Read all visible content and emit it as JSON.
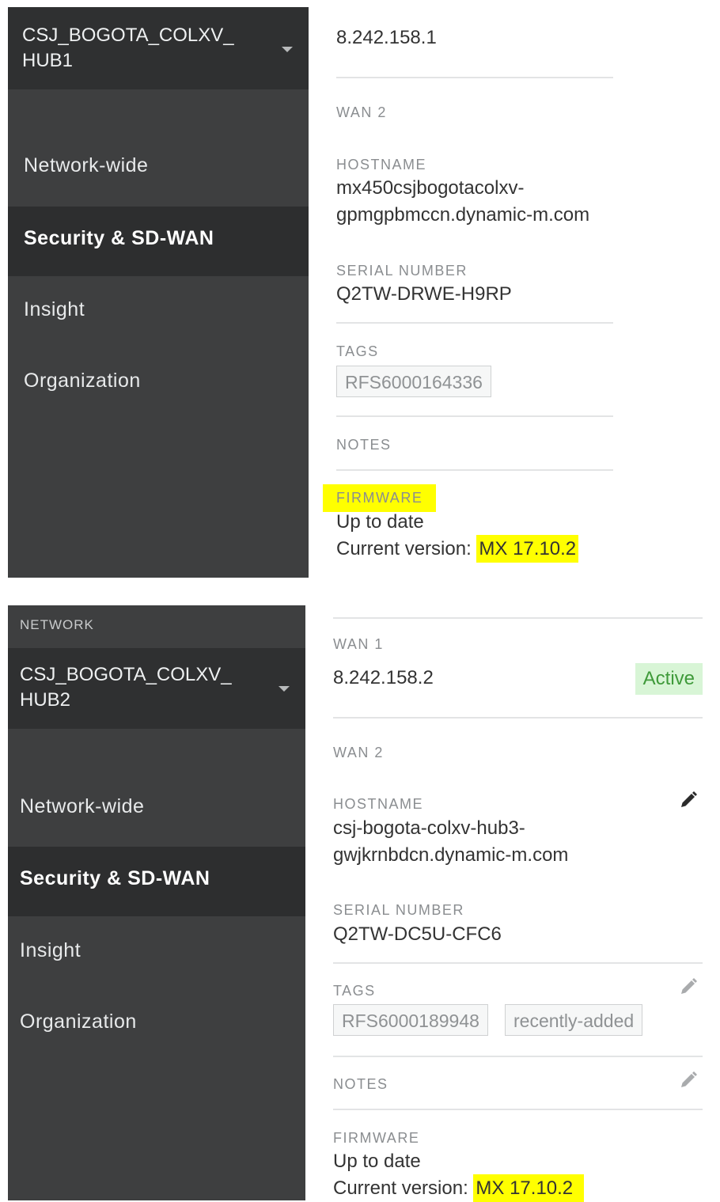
{
  "top": {
    "network_select": "CSJ_BOGOTA_COLXV_\nHUB1",
    "nav": [
      "Network-wide",
      "Security & SD-WAN",
      "Insight",
      "Organization"
    ],
    "wan1_value": "8.242.158.1",
    "wan2_label": "WAN 2",
    "hostname_label": "HOSTNAME",
    "hostname_line1": "mx450csjbogotacolxv-",
    "hostname_line2": "gpmgpbmccn.dynamic-m.com",
    "serial_label": "SERIAL NUMBER",
    "serial_value": "Q2TW-DRWE-H9RP",
    "tags_label": "TAGS",
    "tags": [
      "RFS6000164336"
    ],
    "notes_label": "NOTES",
    "firmware_label": "FIRMWARE",
    "firmware_status": "Up to date",
    "current_version_label": "Current version: ",
    "current_version": "MX 17.10.2"
  },
  "bottom": {
    "network_label": "NETWORK",
    "network_select": "CSJ_BOGOTA_COLXV_\nHUB2",
    "nav": [
      "Network-wide",
      "Security & SD-WAN",
      "Insight",
      "Organization"
    ],
    "wan1_label": "WAN 1",
    "wan1_value": "8.242.158.2",
    "wan1_status": "Active",
    "wan2_label": "WAN 2",
    "hostname_label": "HOSTNAME",
    "hostname_line1": "csj-bogota-colxv-hub3-",
    "hostname_line2": "gwjkrnbdcn.dynamic-m.com",
    "serial_label": "SERIAL NUMBER",
    "serial_value": "Q2TW-DC5U-CFC6",
    "tags_label": "TAGS",
    "tags": [
      "RFS6000189948",
      "recently-added"
    ],
    "notes_label": "NOTES",
    "firmware_label": "FIRMWARE",
    "firmware_status": "Up to date",
    "current_version_label": "Current version: ",
    "current_version": "MX 17.10.2"
  },
  "colors": {
    "sidebar_bg": "#3e3f40",
    "sidebar_active_bg": "#2d2e2f",
    "highlight": "#ffff00",
    "active_badge_bg": "#d8f5d6",
    "active_badge_text": "#3f9a3a"
  },
  "icons": [
    "chevron-down-icon",
    "pencil-icon"
  ]
}
